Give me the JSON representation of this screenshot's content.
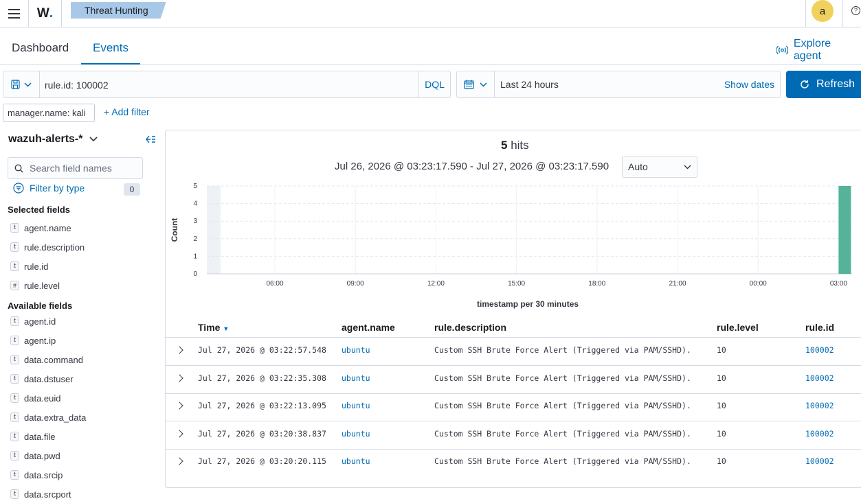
{
  "header": {
    "logo_text": "W",
    "breadcrumb": "Threat Hunting",
    "avatar_letter": "a",
    "help_symbol": "?"
  },
  "tabs": [
    {
      "label": "Dashboard",
      "active": false
    },
    {
      "label": "Events",
      "active": true
    }
  ],
  "explore_agent_label": "Explore agent",
  "query": {
    "text": "rule.id: 100002",
    "language": "DQL"
  },
  "time": {
    "quick_range": "Last 24 hours",
    "show_dates_label": "Show dates",
    "refresh_label": "Refresh"
  },
  "filters": {
    "pill": "manager.name: kali",
    "add_label": "+ Add filter"
  },
  "sidebar": {
    "index_pattern": "wazuh-alerts-*",
    "search_placeholder": "Search field names",
    "filter_by_type_label": "Filter by type",
    "filter_count": "0",
    "selected_title": "Selected fields",
    "selected_fields": [
      {
        "name": "agent.name",
        "type": "t"
      },
      {
        "name": "rule.description",
        "type": "t"
      },
      {
        "name": "rule.id",
        "type": "t"
      },
      {
        "name": "rule.level",
        "type": "#"
      }
    ],
    "available_title": "Available fields",
    "available_fields": [
      {
        "name": "agent.id",
        "type": "t"
      },
      {
        "name": "agent.ip",
        "type": "t"
      },
      {
        "name": "data.command",
        "type": "t"
      },
      {
        "name": "data.dstuser",
        "type": "t"
      },
      {
        "name": "data.euid",
        "type": "t"
      },
      {
        "name": "data.extra_data",
        "type": "t"
      },
      {
        "name": "data.file",
        "type": "t"
      },
      {
        "name": "data.pwd",
        "type": "t"
      },
      {
        "name": "data.srcip",
        "type": "t"
      },
      {
        "name": "data.srcport",
        "type": "t"
      }
    ]
  },
  "results": {
    "hits_count": "5",
    "hits_label": "hits",
    "range_text": "Jul 26, 2026 @ 03:23:17.590 - Jul 27, 2026 @ 03:23:17.590",
    "interval": "Auto"
  },
  "chart_data": {
    "type": "bar",
    "ylabel": "Count",
    "xlabel": "timestamp per 30 minutes",
    "y_ticks": [
      "0",
      "1",
      "2",
      "3",
      "4",
      "5"
    ],
    "ylim": [
      0,
      5
    ],
    "x_ticks": [
      "06:00",
      "09:00",
      "12:00",
      "15:00",
      "18:00",
      "21:00",
      "00:00",
      "03:00"
    ],
    "bars": [
      {
        "x": "03:00",
        "value": 5
      }
    ],
    "bar_color": "#54b399",
    "grid": true
  },
  "table": {
    "columns": [
      "Time",
      "agent.name",
      "rule.description",
      "rule.level",
      "rule.id"
    ],
    "rows": [
      {
        "time": "Jul 27, 2026 @ 03:22:57.548",
        "agent": "ubuntu",
        "description": "Custom SSH Brute Force Alert (Triggered via PAM/SSHD).",
        "level": "10",
        "rule_id": "100002"
      },
      {
        "time": "Jul 27, 2026 @ 03:22:35.308",
        "agent": "ubuntu",
        "description": "Custom SSH Brute Force Alert (Triggered via PAM/SSHD).",
        "level": "10",
        "rule_id": "100002"
      },
      {
        "time": "Jul 27, 2026 @ 03:22:13.095",
        "agent": "ubuntu",
        "description": "Custom SSH Brute Force Alert (Triggered via PAM/SSHD).",
        "level": "10",
        "rule_id": "100002"
      },
      {
        "time": "Jul 27, 2026 @ 03:20:38.837",
        "agent": "ubuntu",
        "description": "Custom SSH Brute Force Alert (Triggered via PAM/SSHD).",
        "level": "10",
        "rule_id": "100002"
      },
      {
        "time": "Jul 27, 2026 @ 03:20:20.115",
        "agent": "ubuntu",
        "description": "Custom SSH Brute Force Alert (Triggered via PAM/SSHD).",
        "level": "10",
        "rule_id": "100002"
      }
    ]
  },
  "colors": {
    "accent": "#006bb4",
    "breadcrumb_bg": "#a8c8e8",
    "avatar_bg": "#f0d15e"
  }
}
